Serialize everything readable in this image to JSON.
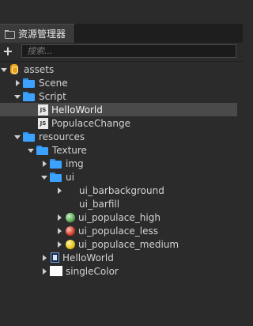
{
  "panel": {
    "title": "资源管理器",
    "search_placeholder": "搜索...",
    "add_label": "+"
  },
  "tree": [
    {
      "label": "assets",
      "icon": "database-icon",
      "expanded": true,
      "level": 0
    },
    {
      "label": "Scene",
      "icon": "folder-icon",
      "expanded": false,
      "level": 1
    },
    {
      "label": "Script",
      "icon": "folder-icon",
      "expanded": true,
      "level": 1
    },
    {
      "label": "HelloWorld",
      "icon": "js-file-icon",
      "selected": true,
      "level": 2
    },
    {
      "label": "PopulaceChange",
      "icon": "js-file-icon",
      "level": 2
    },
    {
      "label": "resources",
      "icon": "folder-icon",
      "expanded": true,
      "level": 1
    },
    {
      "label": "Texture",
      "icon": "folder-icon",
      "expanded": true,
      "level": 2
    },
    {
      "label": "img",
      "icon": "folder-icon",
      "expanded": false,
      "level": 3
    },
    {
      "label": "ui",
      "icon": "folder-icon",
      "expanded": true,
      "level": 3
    },
    {
      "label": "ui_barbackground",
      "icon": "blank-icon",
      "expanded": false,
      "level": 4
    },
    {
      "label": "ui_barfill",
      "icon": "blank-icon",
      "level": 4
    },
    {
      "label": "ui_populace_high",
      "icon": "green-ball-icon",
      "expanded": false,
      "level": 4
    },
    {
      "label": "ui_populace_less",
      "icon": "red-ball-icon",
      "expanded": false,
      "level": 4
    },
    {
      "label": "ui_populace_medium",
      "icon": "yellow-ball-icon",
      "expanded": false,
      "level": 4
    },
    {
      "label": "HelloWorld",
      "icon": "image-thumb-icon",
      "expanded": false,
      "level": 3
    },
    {
      "label": "singleColor",
      "icon": "white-swatch-icon",
      "expanded": false,
      "level": 3
    }
  ]
}
